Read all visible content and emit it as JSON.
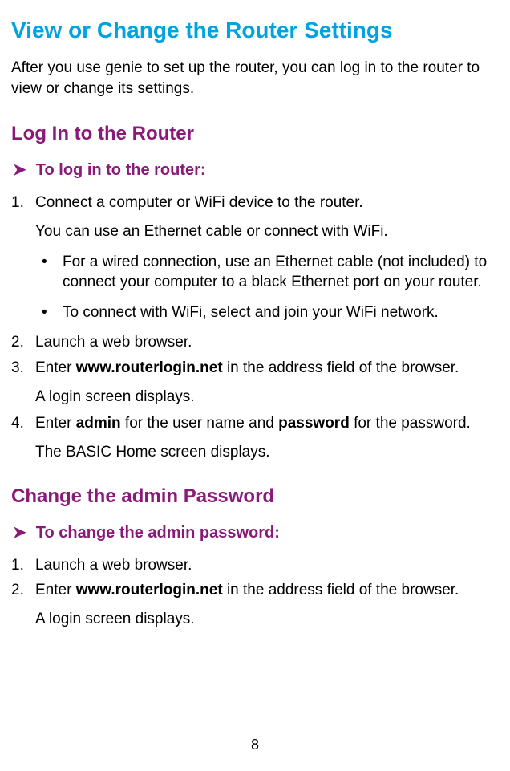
{
  "page": {
    "title": "View or Change the Router Settings",
    "intro": "After you use genie to set up the router, you can log in to the router to view or change its settings.",
    "pageNumber": "8"
  },
  "section1": {
    "heading": "Log In to the Router",
    "procHeading": "To log in to the router:",
    "step1": {
      "text": "Connect a computer or WiFi device to the router.",
      "note": "You can use an Ethernet cable or connect with WiFi.",
      "bulletA": "For a wired connection, use an Ethernet cable (not included) to connect your computer to a black Ethernet port on your router.",
      "bulletB": "To connect with WiFi, select and join your WiFi network."
    },
    "step2": "Launch a web browser.",
    "step3": {
      "pre": "Enter ",
      "bold": "www.routerlogin.net",
      "post": " in the address field of the browser.",
      "note": "A login screen displays."
    },
    "step4": {
      "pre": "Enter ",
      "bold1": "admin",
      "mid": " for the user name and ",
      "bold2": "password",
      "post": " for the password.",
      "note": "The BASIC Home screen displays."
    }
  },
  "section2": {
    "heading": "Change the admin Password",
    "procHeading": "To change the admin password:",
    "step1": "Launch a web browser.",
    "step2": {
      "pre": "Enter ",
      "bold": "www.routerlogin.net",
      "post": " in the address field of the browser.",
      "note": "A login screen displays."
    }
  }
}
